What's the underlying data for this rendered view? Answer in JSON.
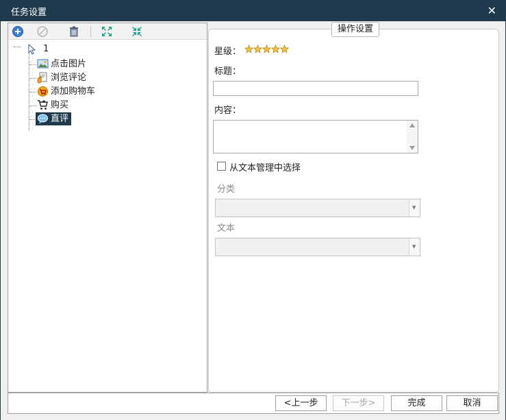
{
  "window": {
    "title": "任务设置",
    "close_glyph": "✕"
  },
  "toolbar": {
    "icons": [
      "add-icon",
      "disabled-circle-icon",
      "trash-icon",
      "expand-icon",
      "collapse-icon"
    ]
  },
  "tree": {
    "root_label": "1",
    "items": [
      {
        "label": "点击图片",
        "icon": "picture-icon"
      },
      {
        "label": "浏览评论",
        "icon": "hand-document-icon"
      },
      {
        "label": "添加购物车",
        "icon": "cart-badge-icon"
      },
      {
        "label": "购买",
        "icon": "shopping-cart-icon"
      },
      {
        "label": "直评",
        "icon": "chat-bubble-icon",
        "selected": true
      }
    ]
  },
  "settings": {
    "group_title": "操作设置",
    "star_label": "星级：",
    "star_rating": 5,
    "title_label": "标题：",
    "title_value": "",
    "content_label": "内容：",
    "content_value": "",
    "checkbox_label": "从文本管理中选择",
    "checkbox_checked": false,
    "category_label": "分类",
    "text_label": "文本"
  },
  "footer": {
    "prev_label": "<上一步",
    "next_label": "下一步>",
    "finish_label": "完成",
    "cancel_label": "取消"
  },
  "colors": {
    "titlebar": "#1f3a4d",
    "selection": "#1f3a4d",
    "star": "#f5c242"
  }
}
